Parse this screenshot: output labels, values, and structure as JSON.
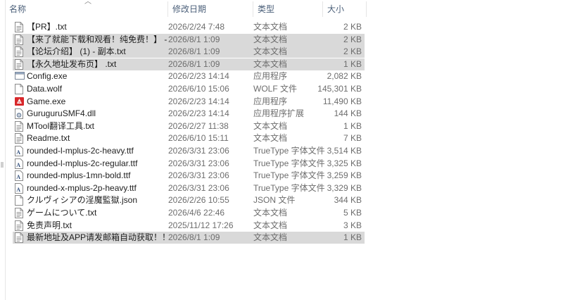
{
  "columns": {
    "name": "名称",
    "date": "修改日期",
    "type": "类型",
    "size": "大小"
  },
  "files": [
    {
      "name": "【PR】.txt",
      "date": "2026/2/24 7:48",
      "type": "文本文档",
      "size": "2 KB",
      "icon": "text-file-icon",
      "selected": false
    },
    {
      "name": "【来了就能下载和观看！纯免费！】 - 副...",
      "date": "2026/8/1 1:09",
      "type": "文本文档",
      "size": "2 KB",
      "icon": "text-file-icon",
      "selected": true
    },
    {
      "name": "【论坛介绍】 (1) - 副本.txt",
      "date": "2026/8/1 1:09",
      "type": "文本文档",
      "size": "2 KB",
      "icon": "text-file-icon",
      "selected": true
    },
    {
      "name": "【永久地址发布页】 .txt",
      "date": "2026/8/1 1:09",
      "type": "文本文档",
      "size": "1 KB",
      "icon": "text-file-icon",
      "selected": true
    },
    {
      "name": "Config.exe",
      "date": "2026/2/23 14:14",
      "type": "应用程序",
      "size": "2,082 KB",
      "icon": "window-app-icon",
      "selected": false
    },
    {
      "name": "Data.wolf",
      "date": "2026/6/10 15:06",
      "type": "WOLF 文件",
      "size": "145,301 KB",
      "icon": "blank-file-icon",
      "selected": false
    },
    {
      "name": "Game.exe",
      "date": "2026/2/23 14:14",
      "type": "应用程序",
      "size": "11,490 KB",
      "icon": "game-app-icon",
      "selected": false
    },
    {
      "name": "GuruguruSMF4.dll",
      "date": "2026/2/23 14:14",
      "type": "应用程序扩展",
      "size": "144 KB",
      "icon": "dll-gear-icon",
      "selected": false
    },
    {
      "name": "MTool翻译工具.txt",
      "date": "2026/2/27 11:38",
      "type": "文本文档",
      "size": "1 KB",
      "icon": "text-file-icon",
      "selected": false
    },
    {
      "name": "Readme.txt",
      "date": "2026/6/10 15:11",
      "type": "文本文档",
      "size": "7 KB",
      "icon": "text-file-icon",
      "selected": false
    },
    {
      "name": "rounded-l-mplus-2c-heavy.ttf",
      "date": "2026/3/31 23:06",
      "type": "TrueType 字体文件",
      "size": "3,514 KB",
      "icon": "font-file-icon",
      "selected": false
    },
    {
      "name": "rounded-l-mplus-2c-regular.ttf",
      "date": "2026/3/31 23:06",
      "type": "TrueType 字体文件",
      "size": "3,325 KB",
      "icon": "font-file-icon",
      "selected": false
    },
    {
      "name": "rounded-mplus-1mn-bold.ttf",
      "date": "2026/3/31 23:06",
      "type": "TrueType 字体文件",
      "size": "3,259 KB",
      "icon": "font-file-icon",
      "selected": false
    },
    {
      "name": "rounded-x-mplus-2p-heavy.ttf",
      "date": "2026/3/31 23:06",
      "type": "TrueType 字体文件",
      "size": "3,329 KB",
      "icon": "font-file-icon",
      "selected": false
    },
    {
      "name": "クルヴィシアの淫魔監獄.json",
      "date": "2026/2/26 10:55",
      "type": "JSON 文件",
      "size": "344 KB",
      "icon": "blank-file-icon",
      "selected": false
    },
    {
      "name": "ゲームについて.txt",
      "date": "2026/4/6 22:46",
      "type": "文本文档",
      "size": "5 KB",
      "icon": "text-file-icon",
      "selected": false
    },
    {
      "name": "免责声明.txt",
      "date": "2025/11/12 17:26",
      "type": "文本文档",
      "size": "3 KB",
      "icon": "text-file-icon",
      "selected": false
    },
    {
      "name": "最新地址及APP请发邮箱自动获取！！！...",
      "date": "2026/8/1 1:09",
      "type": "文本文档",
      "size": "1 KB",
      "icon": "text-file-icon",
      "selected": true
    }
  ],
  "colors": {
    "header_text": "#4c607a",
    "selection": "#d9d9d9",
    "detail_text": "#6d6d6d",
    "game_icon": "#d8282b"
  }
}
